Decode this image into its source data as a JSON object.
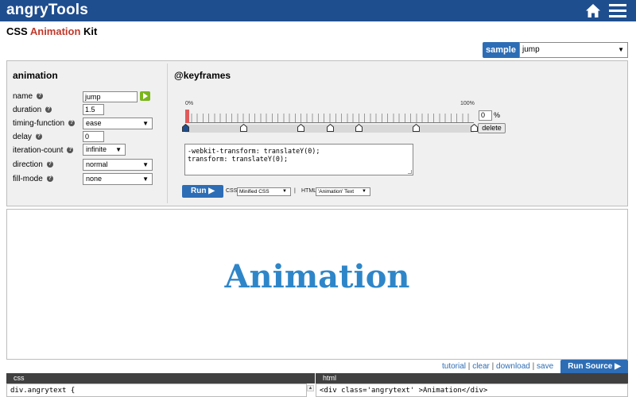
{
  "header": {
    "logo": "angryTools",
    "home_icon": "home-icon",
    "menu_icon": "menu-icon",
    "color": "#1f4e8f"
  },
  "title": {
    "prefix": "CSS ",
    "accent": "Animation",
    "suffix": " Kit"
  },
  "sample": {
    "label": "sample",
    "value": "jump"
  },
  "animation": {
    "heading": "animation",
    "name_label": "name",
    "name_value": "jump",
    "duration_label": "duration",
    "duration_value": "1.5",
    "timing_label": "timing-function",
    "timing_value": "ease",
    "delay_label": "delay",
    "delay_value": "0",
    "iteration_label": "iteration-count",
    "iteration_value": "infinite",
    "direction_label": "direction",
    "direction_value": "normal",
    "fillmode_label": "fill-mode",
    "fillmode_value": "none"
  },
  "keyframes": {
    "heading": "@keyframes",
    "start_label": "0%",
    "end_label": "100%",
    "markers": [
      0,
      20,
      40,
      50,
      60,
      80,
      100
    ],
    "percent_value": "0",
    "percent_sign": "%",
    "delete_label": "delete",
    "code": "-webkit-transform: translateY(0);\ntransform: translateY(0);",
    "run_label": "Run ▶",
    "css_label": "CSS",
    "css_value": "Minified CSS",
    "sep": "|",
    "html_label": "HTML",
    "html_value": "'Animation' Text"
  },
  "preview": {
    "text": "Animation",
    "color": "#2e86c9"
  },
  "links": {
    "tutorial": "tutorial",
    "clear": "clear",
    "download": "download",
    "save": "save",
    "sep": "|"
  },
  "run_source": "Run Source ▶",
  "css_panel": {
    "header": "css",
    "code": "div.angrytext {"
  },
  "html_panel": {
    "header": "html",
    "code": "<div class='angrytext' >Animation</div>"
  }
}
